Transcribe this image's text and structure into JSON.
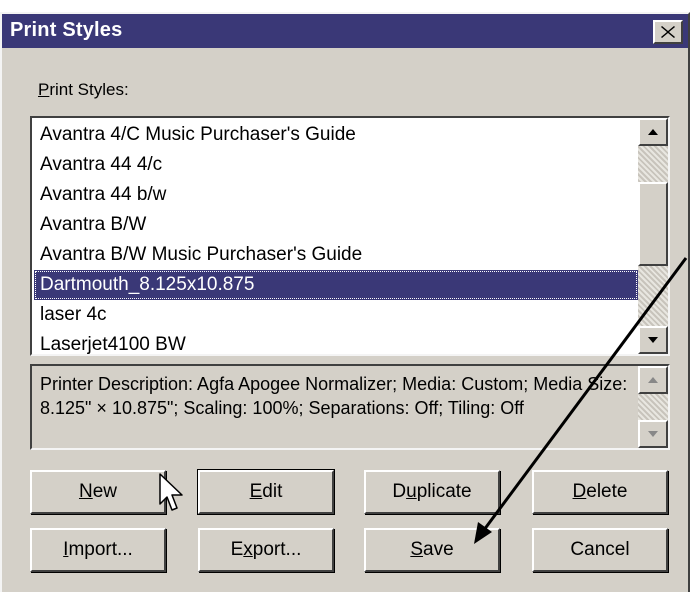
{
  "dialog": {
    "title": "Print Styles",
    "close_icon": "close-x-icon"
  },
  "list": {
    "label_first": "P",
    "label_rest": "rint Styles:",
    "items": [
      "Avantra 4/C Music Purchaser's Guide",
      "Avantra 44 4/c",
      "Avantra 44 b/w",
      "Avantra B/W",
      "Avantra B/W Music Purchaser's Guide",
      "Dartmouth_8.125x10.875",
      "laser 4c",
      "Laserjet4100 BW"
    ],
    "selected_index": 5
  },
  "description": {
    "text": "Printer Description: Agfa Apogee Normalizer;  Media: Custom;  Media Size: 8.125\" × 10.875\";  Scaling: 100%;  Separations: Off;  Tiling: Off"
  },
  "buttons": {
    "new": {
      "pre": "",
      "u": "N",
      "post": "ew"
    },
    "edit": {
      "pre": "",
      "u": "E",
      "post": "dit"
    },
    "duplicate": {
      "pre": "D",
      "u": "u",
      "post": "plicate"
    },
    "delete": {
      "pre": "",
      "u": "D",
      "post": "elete"
    },
    "import": {
      "pre": "",
      "u": "I",
      "post": "mport..."
    },
    "export": {
      "pre": "E",
      "u": "x",
      "post": "port..."
    },
    "save": {
      "pre": "",
      "u": "S",
      "post": "ave"
    },
    "cancel": {
      "pre": "Cancel",
      "u": "",
      "post": ""
    }
  },
  "colors": {
    "title_bar": "#3a3877",
    "dialog_face": "#d4d0c8",
    "selection": "#3a3877"
  },
  "annotation": {
    "arrow_icon": "callout-arrow-icon",
    "cursor_icon": "mouse-pointer-icon"
  }
}
